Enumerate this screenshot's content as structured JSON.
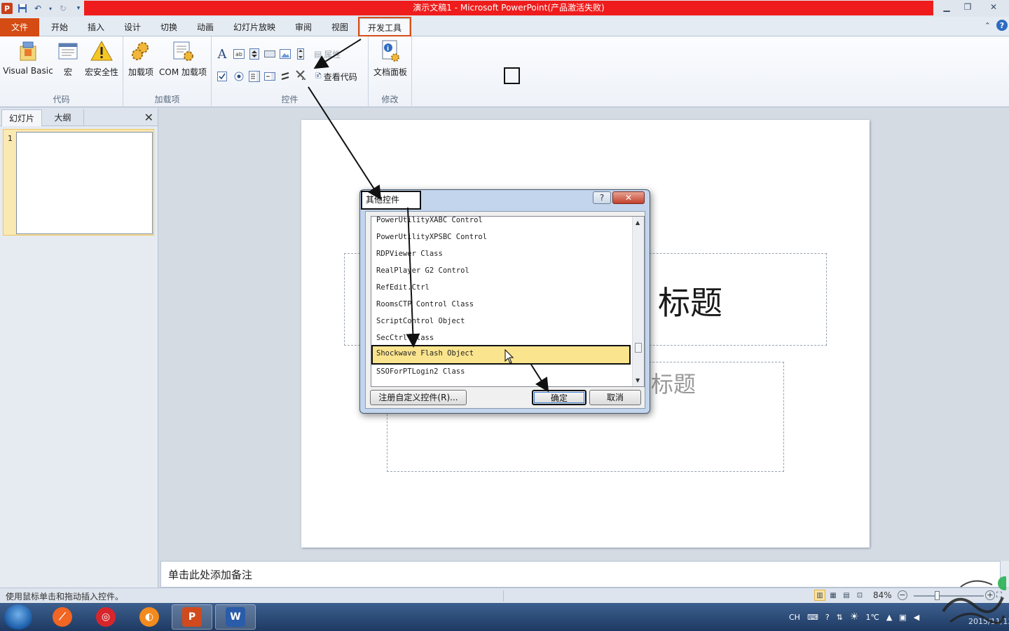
{
  "window": {
    "title": "演示文稿1 - Microsoft PowerPoint(产品激活失败)",
    "app_icon": "P",
    "qat": [
      "save-icon",
      "undo-icon",
      "redo-icon",
      "customize-icon"
    ]
  },
  "tabs": [
    {
      "label": "文件"
    },
    {
      "label": "开始"
    },
    {
      "label": "插入"
    },
    {
      "label": "设计"
    },
    {
      "label": "切换"
    },
    {
      "label": "动画"
    },
    {
      "label": "幻灯片放映"
    },
    {
      "label": "审阅"
    },
    {
      "label": "视图"
    },
    {
      "label": "开发工具"
    }
  ],
  "ribbon": {
    "code": {
      "name": "代码",
      "visual_basic": "Visual Basic",
      "macro": "宏",
      "macro_security": "宏安全性"
    },
    "addins": {
      "name": "加载项",
      "addins": "加载项",
      "com_addins": "COM 加载项"
    },
    "controls": {
      "name": "控件",
      "properties": "属性",
      "view_code": "查看代码"
    },
    "modify": {
      "name": "修改",
      "document_panel": "文档面板"
    }
  },
  "left_panel": {
    "tab_slides": "幻灯片",
    "tab_outline": "大纲",
    "slide_number": "1"
  },
  "slide": {
    "title_placeholder": "标题",
    "subtitle_placeholder": "标题"
  },
  "notes": {
    "placeholder": "单击此处添加备注"
  },
  "statusbar": {
    "message": "使用鼠标单击和拖动插入控件。",
    "zoom": "84%",
    "zoom_out": "−",
    "zoom_in": "+"
  },
  "dialog": {
    "title": "其他控件",
    "help": "?",
    "close": "✕",
    "items": [
      "PowerUtilityXABC Control",
      "PowerUtilityXPSBC Control",
      "RDPViewer Class",
      "RealPlayer G2 Control",
      "RefEdit.Ctrl",
      "RoomsCTP Control Class",
      "ScriptControl Object",
      "SecCtrl Class",
      "Shockwave Flash Object",
      "SSOForPTLogin2 Class"
    ],
    "selected_index": 8,
    "register_button": "注册自定义控件(R)...",
    "ok_button": "确定",
    "cancel_button": "取消"
  },
  "taskbar": {
    "tray_lang": "CH",
    "temperature": "1℃",
    "date": "2015/11/13"
  },
  "colors": {
    "title_red": "#ee1c1c",
    "file_tab": "#d44b13",
    "dev_tab_highlight": "#d4501a",
    "selection_yellow": "#fbe48e"
  }
}
